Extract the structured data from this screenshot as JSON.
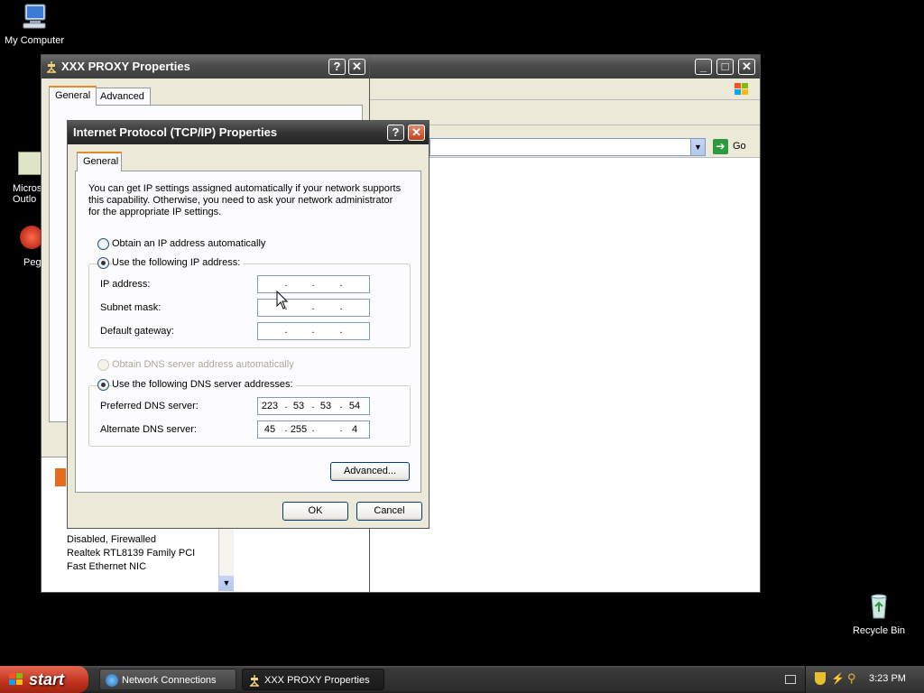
{
  "desktop": {
    "my_computer": "My Computer",
    "outlook_partial": "Micros\nOutlo",
    "pegasus_partial": "Peg",
    "recycle_bin": "Recycle Bin"
  },
  "browser": {
    "go_label": "Go"
  },
  "proxy": {
    "title": "XXX PROXY Properties",
    "tabs": [
      "General",
      "Advanced"
    ],
    "status_lines": [
      "Disabled, Firewalled",
      "Realtek RTL8139 Family PCI",
      "Fast Ethernet NIC"
    ]
  },
  "tcpip": {
    "title": "Internet Protocol (TCP/IP) Properties",
    "tab": "General",
    "intro": "You can get IP settings assigned automatically if your network supports this capability. Otherwise, you need to ask your network administrator for the appropriate IP settings.",
    "ip_auto": "Obtain an IP address automatically",
    "ip_manual": "Use the following IP address:",
    "ip_address_label": "IP address:",
    "subnet_label": "Subnet mask:",
    "gateway_label": "Default gateway:",
    "dns_auto": "Obtain DNS server address automatically",
    "dns_manual": "Use the following DNS server addresses:",
    "preferred_label": "Preferred DNS server:",
    "alternate_label": "Alternate DNS server:",
    "ip_address": [
      "",
      "",
      "",
      ""
    ],
    "subnet": [
      "",
      "",
      "",
      ""
    ],
    "gateway": [
      "",
      "",
      "",
      ""
    ],
    "preferred_dns": [
      "223",
      "53",
      "53",
      "54"
    ],
    "alternate_dns": [
      "45",
      "255",
      "",
      "4"
    ],
    "advanced_btn": "Advanced...",
    "ok_btn": "OK",
    "cancel_btn": "Cancel"
  },
  "taskbar": {
    "start": "start",
    "tasks": [
      "Network Connections",
      "XXX PROXY Properties"
    ],
    "clock": "3:23 PM"
  },
  "colors": {
    "desktop_bg": "#000000",
    "dialog_bg": "#ECE9D8",
    "close_red": "#c4421e",
    "start_red": "#c0321b"
  }
}
